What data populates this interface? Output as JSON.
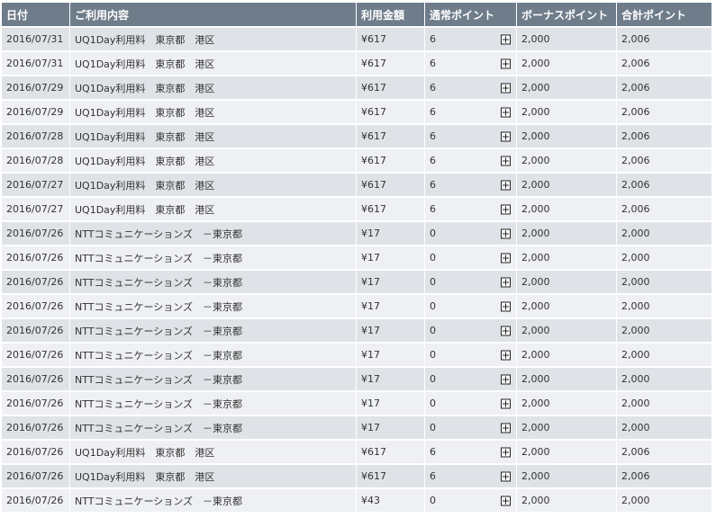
{
  "headers": {
    "date": "日付",
    "description": "ご利用内容",
    "amount": "利用金額",
    "normal_points": "通常ポイント",
    "bonus_points": "ボーナスポイント",
    "total_points": "合計ポイント"
  },
  "icons": {
    "expand": "plus-box-icon"
  },
  "rows": [
    {
      "date": "2016/07/31",
      "description": "UQ1Day利用料　東京都　港区",
      "amount": "¥617",
      "normal_points": "6",
      "bonus_points": "2,000",
      "total_points": "2,006"
    },
    {
      "date": "2016/07/31",
      "description": "UQ1Day利用料　東京都　港区",
      "amount": "¥617",
      "normal_points": "6",
      "bonus_points": "2,000",
      "total_points": "2,006"
    },
    {
      "date": "2016/07/29",
      "description": "UQ1Day利用料　東京都　港区",
      "amount": "¥617",
      "normal_points": "6",
      "bonus_points": "2,000",
      "total_points": "2,006"
    },
    {
      "date": "2016/07/29",
      "description": "UQ1Day利用料　東京都　港区",
      "amount": "¥617",
      "normal_points": "6",
      "bonus_points": "2,000",
      "total_points": "2,006"
    },
    {
      "date": "2016/07/28",
      "description": "UQ1Day利用料　東京都　港区",
      "amount": "¥617",
      "normal_points": "6",
      "bonus_points": "2,000",
      "total_points": "2,006"
    },
    {
      "date": "2016/07/28",
      "description": "UQ1Day利用料　東京都　港区",
      "amount": "¥617",
      "normal_points": "6",
      "bonus_points": "2,000",
      "total_points": "2,006"
    },
    {
      "date": "2016/07/27",
      "description": "UQ1Day利用料　東京都　港区",
      "amount": "¥617",
      "normal_points": "6",
      "bonus_points": "2,000",
      "total_points": "2,006"
    },
    {
      "date": "2016/07/27",
      "description": "UQ1Day利用料　東京都　港区",
      "amount": "¥617",
      "normal_points": "6",
      "bonus_points": "2,000",
      "total_points": "2,006"
    },
    {
      "date": "2016/07/26",
      "description": "NTTコミュニケーションズ　－東京都",
      "amount": "¥17",
      "normal_points": "0",
      "bonus_points": "2,000",
      "total_points": "2,000"
    },
    {
      "date": "2016/07/26",
      "description": "NTTコミュニケーションズ　－東京都",
      "amount": "¥17",
      "normal_points": "0",
      "bonus_points": "2,000",
      "total_points": "2,000"
    },
    {
      "date": "2016/07/26",
      "description": "NTTコミュニケーションズ　－東京都",
      "amount": "¥17",
      "normal_points": "0",
      "bonus_points": "2,000",
      "total_points": "2,000"
    },
    {
      "date": "2016/07/26",
      "description": "NTTコミュニケーションズ　－東京都",
      "amount": "¥17",
      "normal_points": "0",
      "bonus_points": "2,000",
      "total_points": "2,000"
    },
    {
      "date": "2016/07/26",
      "description": "NTTコミュニケーションズ　－東京都",
      "amount": "¥17",
      "normal_points": "0",
      "bonus_points": "2,000",
      "total_points": "2,000"
    },
    {
      "date": "2016/07/26",
      "description": "NTTコミュニケーションズ　－東京都",
      "amount": "¥17",
      "normal_points": "0",
      "bonus_points": "2,000",
      "total_points": "2,000"
    },
    {
      "date": "2016/07/26",
      "description": "NTTコミュニケーションズ　－東京都",
      "amount": "¥17",
      "normal_points": "0",
      "bonus_points": "2,000",
      "total_points": "2,000"
    },
    {
      "date": "2016/07/26",
      "description": "NTTコミュニケーションズ　－東京都",
      "amount": "¥17",
      "normal_points": "0",
      "bonus_points": "2,000",
      "total_points": "2,000"
    },
    {
      "date": "2016/07/26",
      "description": "NTTコミュニケーションズ　－東京都",
      "amount": "¥17",
      "normal_points": "0",
      "bonus_points": "2,000",
      "total_points": "2,000"
    },
    {
      "date": "2016/07/26",
      "description": "UQ1Day利用料　東京都　港区",
      "amount": "¥617",
      "normal_points": "6",
      "bonus_points": "2,000",
      "total_points": "2,006"
    },
    {
      "date": "2016/07/26",
      "description": "UQ1Day利用料　東京都　港区",
      "amount": "¥617",
      "normal_points": "6",
      "bonus_points": "2,000",
      "total_points": "2,006"
    },
    {
      "date": "2016/07/26",
      "description": "NTTコミュニケーションズ　－東京都",
      "amount": "¥43",
      "normal_points": "0",
      "bonus_points": "2,000",
      "total_points": "2,000"
    }
  ]
}
